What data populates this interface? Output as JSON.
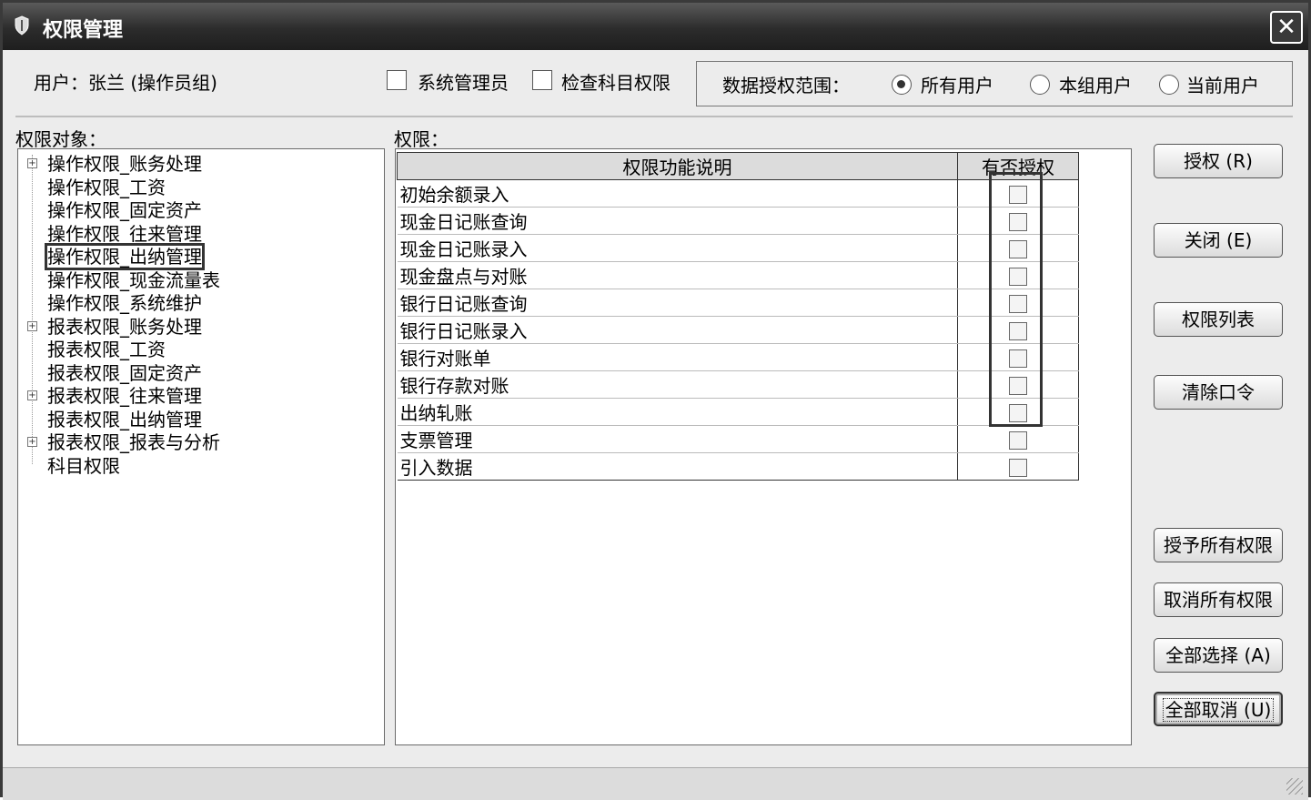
{
  "window": {
    "title": "权限管理",
    "close_glyph": "✕"
  },
  "user": {
    "label": "用户：张兰 (操作员组)"
  },
  "options": {
    "sys_admin": {
      "label": "系统管理员",
      "checked": false
    },
    "check_subject": {
      "label": "检查科目权限",
      "checked": false
    }
  },
  "scope": {
    "title": "数据授权范围：",
    "options": [
      {
        "label": "所有用户",
        "selected": true
      },
      {
        "label": "本组用户",
        "selected": false
      },
      {
        "label": "当前用户",
        "selected": false
      }
    ]
  },
  "tree": {
    "label": "权限对象：",
    "items": [
      {
        "label": "操作权限_账务处理",
        "expandable": true
      },
      {
        "label": "操作权限_工资",
        "expandable": false
      },
      {
        "label": "操作权限_固定资产",
        "expandable": false
      },
      {
        "label": "操作权限_往来管理",
        "expandable": false
      },
      {
        "label": "操作权限_出纳管理",
        "expandable": false,
        "selected": true
      },
      {
        "label": "操作权限_现金流量表",
        "expandable": false
      },
      {
        "label": "操作权限_系统维护",
        "expandable": false
      },
      {
        "label": "报表权限_账务处理",
        "expandable": true
      },
      {
        "label": "报表权限_工资",
        "expandable": false
      },
      {
        "label": "报表权限_固定资产",
        "expandable": false
      },
      {
        "label": "报表权限_往来管理",
        "expandable": true
      },
      {
        "label": "报表权限_出纳管理",
        "expandable": false
      },
      {
        "label": "报表权限_报表与分析",
        "expandable": true
      },
      {
        "label": "科目权限",
        "expandable": false
      }
    ]
  },
  "permissions": {
    "label": "权限：",
    "columns": [
      "权限功能说明",
      "有否授权"
    ],
    "rows": [
      {
        "name": "初始余额录入",
        "granted": false
      },
      {
        "name": "现金日记账查询",
        "granted": false
      },
      {
        "name": "现金日记账录入",
        "granted": false
      },
      {
        "name": "现金盘点与对账",
        "granted": false
      },
      {
        "name": "银行日记账查询",
        "granted": false
      },
      {
        "name": "银行日记账录入",
        "granted": false
      },
      {
        "name": "银行对账单",
        "granted": false
      },
      {
        "name": "银行存款对账",
        "granted": false
      },
      {
        "name": "出纳轧账",
        "granted": false
      },
      {
        "name": "支票管理",
        "granted": false
      },
      {
        "name": "引入数据",
        "granted": false
      }
    ]
  },
  "buttons": {
    "grant": "授权 (R)",
    "close": "关闭 (E)",
    "perm_list": "权限列表",
    "clear_password": "清除口令",
    "grant_all": "授予所有权限",
    "revoke_all": "取消所有权限",
    "select_all": "全部选择 (A)",
    "deselect_all": "全部取消 (U)"
  }
}
